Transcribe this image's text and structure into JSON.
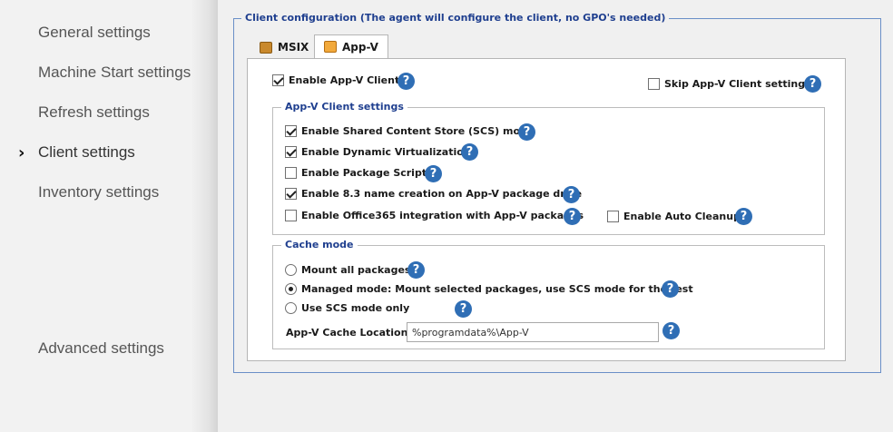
{
  "sidebar": {
    "items": [
      {
        "label": "General settings"
      },
      {
        "label": "Machine Start settings"
      },
      {
        "label": "Refresh settings"
      },
      {
        "label": "Client settings"
      },
      {
        "label": "Inventory settings"
      },
      {
        "label": "Advanced settings"
      }
    ],
    "active_chevron": "›"
  },
  "client_config": {
    "title": "Client configuration (The agent will configure the client, no GPO's needed)",
    "tabs": [
      {
        "label": "MSIX",
        "icon": "msix-package-icon"
      },
      {
        "label": "App-V",
        "icon": "appv-package-icon"
      }
    ],
    "enable_appv_client": "Enable App-V Client",
    "skip_appv_client_settings": "Skip App-V Client settings",
    "appv_client_settings": {
      "title": "App-V Client settings",
      "scs_mode": "Enable Shared Content Store (SCS) mode",
      "dynamic_virtualization": "Enable Dynamic Virtualization",
      "package_scripts": "Enable Package Scripts",
      "name_creation": "Enable 8.3 name creation on App-V package drive",
      "office365": "Enable Office365 integration with App-V packages",
      "auto_cleanup": "Enable Auto Cleanup"
    },
    "cache_mode": {
      "title": "Cache mode",
      "mount_all": "Mount all packages",
      "managed_mode": "Managed mode: Mount selected packages, use SCS mode for the rest",
      "scs_only": "Use SCS mode only",
      "location_label": "App-V Cache Location:",
      "location_value": "%programdata%\\App-V"
    },
    "help_glyph": "?"
  }
}
